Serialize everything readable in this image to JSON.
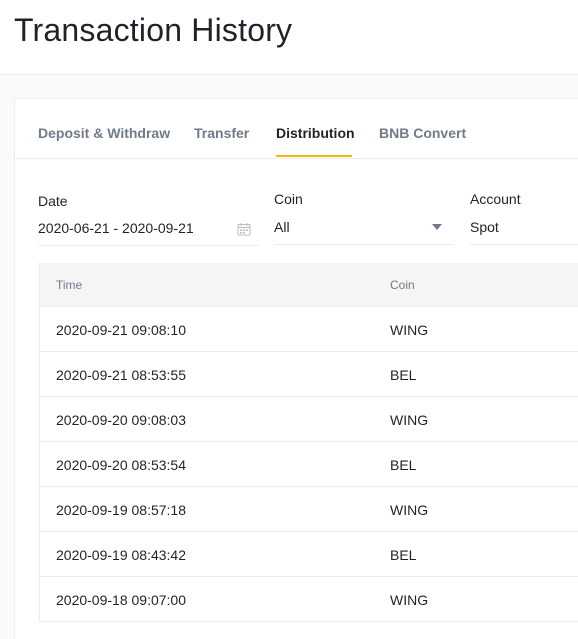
{
  "header": {
    "title": "Transaction History"
  },
  "tabs": [
    {
      "label": "Deposit & Withdraw",
      "active": false
    },
    {
      "label": "Transfer",
      "active": false
    },
    {
      "label": "Distribution",
      "active": true
    },
    {
      "label": "BNB Convert",
      "active": false
    }
  ],
  "filters": {
    "date": {
      "label": "Date",
      "value": "2020-06-21 - 2020-09-21",
      "icon": "calendar-icon"
    },
    "coin": {
      "label": "Coin",
      "value": "All",
      "icon": "caret-down-icon"
    },
    "account": {
      "label": "Account",
      "value": "Spot"
    }
  },
  "table": {
    "columns": [
      "Time",
      "Coin"
    ],
    "rows": [
      {
        "time": "2020-09-21 09:08:10",
        "coin": "WING"
      },
      {
        "time": "2020-09-21 08:53:55",
        "coin": "BEL"
      },
      {
        "time": "2020-09-20 09:08:03",
        "coin": "WING"
      },
      {
        "time": "2020-09-20 08:53:54",
        "coin": "BEL"
      },
      {
        "time": "2020-09-19 08:57:18",
        "coin": "WING"
      },
      {
        "time": "2020-09-19 08:43:42",
        "coin": "BEL"
      },
      {
        "time": "2020-09-18 09:07:00",
        "coin": "WING"
      }
    ]
  },
  "colors": {
    "accent": "#f0b90b",
    "text": "#1e2329",
    "muted": "#707a8a"
  }
}
